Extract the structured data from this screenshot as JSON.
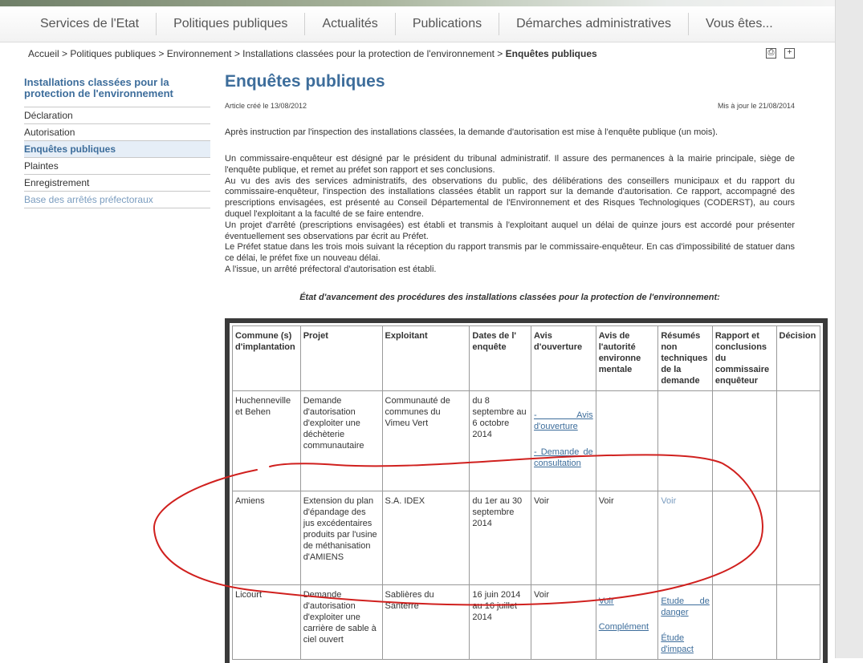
{
  "nav": {
    "items": [
      "Services de l'Etat",
      "Politiques publiques",
      "Actualités",
      "Publications",
      "Démarches administratives",
      "Vous êtes..."
    ]
  },
  "breadcrumb": {
    "path": "Accueil > Politiques publiques > Environnement > Installations classées pour la protection de l'environnement >",
    "current": "Enquêtes publiques"
  },
  "tools": {
    "print_glyph": "⎙",
    "plus_glyph": "+"
  },
  "sidebar": {
    "title": "Installations classées pour la protection de l'environnement",
    "items": [
      {
        "label": "Déclaration"
      },
      {
        "label": "Autorisation"
      },
      {
        "label": "Enquêtes publiques"
      },
      {
        "label": "Plaintes"
      },
      {
        "label": "Enregistrement"
      },
      {
        "label": "Base des arrêtés préfectoraux"
      }
    ]
  },
  "article": {
    "title": "Enquêtes publiques",
    "created": "Article créé le 13/08/2012",
    "updated": "Mis à jour le 21/08/2014",
    "intro": "Après instruction par l'inspection des installations classées, la demande d'autorisation est mise à l'enquête publique (un mois).",
    "paragraphs": [
      "Un commissaire-enquêteur est désigné par le président du tribunal administratif. Il assure des permanences à la mairie principale, siège de l'enquête publique, et remet au préfet son rapport et ses conclusions.",
      "Au vu des avis des services administratifs, des observations du public, des délibérations des conseillers municipaux et du rapport du commissaire-enquêteur, l'inspection des installations classées établit un rapport sur la demande d'autorisation. Ce rapport, accompagné des prescriptions envisagées, est présenté au Conseil Départemental de l'Environnement et des Risques Technologiques (CODERST), au cours duquel l'exploitant a la faculté de se faire entendre.",
      "Un projet d'arrêté (prescriptions envisagées) est établi et transmis à l'exploitant auquel un délai de quinze jours est accordé pour présenter éventuellement ses observations par écrit au Préfet.",
      "Le Préfet statue dans les trois mois suivant la réception du rapport transmis par le commissaire-enquêteur. En cas d'impossibilité de statuer dans ce délai, le préfet fixe un nouveau délai.",
      "A l'issue, un arrêté préfectoral d'autorisation est établi."
    ],
    "table_caption": "État d'avancement des procédures des installations classées pour la protection de l'environnement:"
  },
  "table": {
    "headers": [
      "Commune (s) d'implantation",
      "Projet",
      "Exploitant",
      "Dates de l' enquête",
      "Avis d'ouverture",
      "Avis de l'autorité environne mentale",
      "Résumés non techniques de la demande",
      "Rapport et conclusions du commissaire enquêteur",
      "Décision"
    ],
    "rows": [
      {
        "commune": "Huchenneville et Behen",
        "projet": "Demande d'autorisation d'exploiter une déchèterie communautaire",
        "exploitant": "Communauté de communes du Vimeu Vert",
        "dates": "du 8 septembre au 6 octobre 2014",
        "avis_link1": "- Avis d'ouverture",
        "avis_link2": "- Demande de consultation"
      },
      {
        "commune": "Amiens",
        "projet": "Extension du plan d'épandage des jus excédentaires produits par l'usine de méthanisation d'AMIENS",
        "exploitant": "S.A. IDEX",
        "dates": "du 1er au 30 septembre 2014",
        "avis": "Voir",
        "autorite": "Voir",
        "resume": "Voir"
      },
      {
        "commune": "Licourt",
        "projet": "Demande d'autorisation d'exploiter une carrière de sable à ciel ouvert",
        "exploitant": "Sablières du Santerre",
        "dates": "16 juin 2014 au 16 juillet 2014",
        "avis": "Voir",
        "autorite_link1": "Voir",
        "autorite_link2": "Complément",
        "resume_link1": "Etude de danger",
        "resume_link2": "Étude d'impact"
      }
    ]
  },
  "annotation": {
    "color": "#d0201e"
  }
}
